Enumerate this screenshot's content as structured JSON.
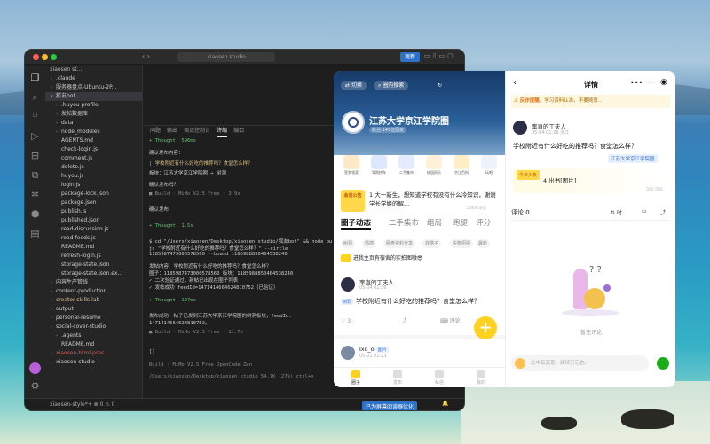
{
  "vscode": {
    "title": "xiaosen studio",
    "title_button": "更新",
    "explorer_root": "xiaosen st...",
    "tree": [
      {
        "label": ".claude",
        "type": "folder",
        "color": "normal",
        "indent": 1,
        "selected": false
      },
      {
        "label": "服务器盘点-Ubuntu-2P...",
        "type": "folder",
        "color": "normal",
        "indent": 1,
        "selected": false
      },
      {
        "label": "狐友bot",
        "type": "folder-open",
        "color": "normal",
        "indent": 1,
        "selected": true
      },
      {
        "label": ".huyou-profile",
        "type": "folder",
        "color": "normal",
        "indent": 2,
        "selected": false
      },
      {
        "label": "发帖数据库",
        "type": "folder",
        "color": "normal",
        "indent": 2,
        "selected": false
      },
      {
        "label": "data",
        "type": "folder",
        "color": "normal",
        "indent": 2,
        "selected": false
      },
      {
        "label": "node_modules",
        "type": "folder",
        "color": "normal",
        "indent": 2,
        "selected": false
      },
      {
        "label": "AGENTS.md",
        "type": "file",
        "color": "normal",
        "indent": 2,
        "selected": false
      },
      {
        "label": "check-login.js",
        "type": "file",
        "color": "normal",
        "indent": 2,
        "selected": false
      },
      {
        "label": "comment.js",
        "type": "file",
        "color": "normal",
        "indent": 2,
        "selected": false
      },
      {
        "label": "delete.js",
        "type": "file",
        "color": "normal",
        "indent": 2,
        "selected": false
      },
      {
        "label": "huyou.js",
        "type": "file",
        "color": "normal",
        "indent": 2,
        "selected": false
      },
      {
        "label": "login.js",
        "type": "file",
        "color": "normal",
        "indent": 2,
        "selected": false
      },
      {
        "label": "package-lock.json",
        "type": "file",
        "color": "normal",
        "indent": 2,
        "selected": false
      },
      {
        "label": "package.json",
        "type": "file",
        "color": "normal",
        "indent": 2,
        "selected": false
      },
      {
        "label": "publish.js",
        "type": "file",
        "color": "normal",
        "indent": 2,
        "selected": false
      },
      {
        "label": "published.json",
        "type": "file",
        "color": "normal",
        "indent": 2,
        "selected": false
      },
      {
        "label": "read-discussion.js",
        "type": "file",
        "color": "normal",
        "indent": 2,
        "selected": false
      },
      {
        "label": "read-feeds.js",
        "type": "file",
        "color": "normal",
        "indent": 2,
        "selected": false
      },
      {
        "label": "README.md",
        "type": "file",
        "color": "normal",
        "indent": 2,
        "selected": false
      },
      {
        "label": "refresh-login.js",
        "type": "file",
        "color": "normal",
        "indent": 2,
        "selected": false
      },
      {
        "label": "storage-state.json",
        "type": "file",
        "color": "normal",
        "indent": 2,
        "selected": false
      },
      {
        "label": "storage-state.json.ex...",
        "type": "file",
        "color": "normal",
        "indent": 2,
        "selected": false
      },
      {
        "label": "内容生产管线",
        "type": "folder",
        "color": "normal",
        "indent": 1,
        "selected": false
      },
      {
        "label": "content-production",
        "type": "folder",
        "color": "normal",
        "indent": 1,
        "selected": false
      },
      {
        "label": "creator-skills-lab",
        "type": "folder",
        "color": "orange",
        "indent": 1,
        "selected": false
      },
      {
        "label": "output",
        "type": "folder",
        "color": "normal",
        "indent": 1,
        "selected": false
      },
      {
        "label": "personal-resume",
        "type": "folder",
        "color": "normal",
        "indent": 1,
        "selected": false
      },
      {
        "label": "social-cover-studio",
        "type": "folder",
        "color": "normal",
        "indent": 1,
        "selected": false
      },
      {
        "label": ".agents",
        "type": "folder",
        "color": "normal",
        "indent": 2,
        "selected": false
      },
      {
        "label": "README.md",
        "type": "file",
        "color": "normal",
        "indent": 2,
        "selected": false
      },
      {
        "label": "xiaosen-html-pres...",
        "type": "folder",
        "color": "red",
        "indent": 1,
        "selected": false
      },
      {
        "label": "xiaosen-studio",
        "type": "folder",
        "color": "normal",
        "indent": 1,
        "selected": false
      }
    ],
    "panel_tabs": [
      "问题",
      "输出",
      "调试控制台",
      "终端",
      "端口"
    ],
    "active_panel_tab": "终端",
    "terminal_lines": [
      {
        "text": "+ Thought: 596ms",
        "style": "g"
      },
      {
        "text": "确认发布内容：",
        "style": ""
      },
      {
        "text": "| 学校附近有什么好吃的推荐吗？食堂怎么样？",
        "style": "y"
      },
      {
        "text": "板块：江苏大学京江学院圈 → 树洞",
        "style": ""
      },
      {
        "text": "确认发布吗？",
        "style": ""
      },
      {
        "text": "■  Build · MiMo V2.5 Free · 3.9s",
        "style": "dim"
      },
      {
        "text": "确认发布",
        "style": ""
      },
      {
        "text": "+ Thought: 1.5s",
        "style": "g"
      },
      {
        "text": "$ cd \"/Users/xiaosen/Desktop/xiaosen studio/狐友bot\" && node pu",
        "style": ""
      },
      {
        "text": "js \"学校附近有什么好吃的推荐吗？食堂怎么样？\" --circle",
        "style": ""
      },
      {
        "text": "1185987473000578560 --board 1185988850464538240",
        "style": ""
      },
      {
        "text": "发帖内容：学校附近有什么好吃的推荐吗？食堂怎么样？",
        "style": ""
      },
      {
        "text": "圈子：1185987473000578560 板块：1185988850464538240",
        "style": ""
      },
      {
        "text": "✓ 二次验证通过，新帖已出现在圈子列表",
        "style": ""
      },
      {
        "text": "✓ 发帖成功 feedId=1471414664624810752（已验证）",
        "style": ""
      },
      {
        "text": "+ Thought: 107ms",
        "style": "g"
      },
      {
        "text": "发布成功！帖子已发到江苏大学京江学院圈的树洞板块，feedId:",
        "style": ""
      },
      {
        "text": "1471414664624810752。",
        "style": ""
      },
      {
        "text": "■  Build · MiMo V2.5 Free · 11.7s",
        "style": "dim"
      },
      {
        "text": "[]",
        "style": ""
      },
      {
        "text": "Build · MiMo V2.5 Free OpenCode Zen",
        "style": "dim"
      },
      {
        "text": "/Users/xiaosen/Desktop/xiaosen studio         54.7K (27%)    ctrl+p",
        "style": "dim"
      }
    ],
    "status_left": "xiaosen-style*+  ⊗ 0 ⚠ 0",
    "status_button": "已为屏幕阅读器优化"
  },
  "mini_program": {
    "switch_label": "切换",
    "search_label": "圈内搜索",
    "school_name": "江苏大学京江学院圈",
    "school_stats": "粉丝·149位圈友",
    "categories": [
      {
        "label": "签到领奖",
        "icon": "gift-icon"
      },
      {
        "label": "驾照拼车",
        "icon": "car-icon"
      },
      {
        "label": "二手集市",
        "icon": "cart-icon"
      },
      {
        "label": "校园同乐",
        "icon": "mascot-icon"
      },
      {
        "label": "京江百科",
        "icon": "book-icon"
      },
      {
        "label": "玩吧",
        "icon": "game-icon"
      }
    ],
    "notice_badge": "会员公告",
    "notice_text": "1 大一新生，想知道学校有没有什么冷知识，谢谢学长学姐的解...",
    "notice_meta": "5064 浏览",
    "tabs": [
      "圈子动态",
      "二手集市",
      "组局",
      "跑腿",
      "评分"
    ],
    "active_tab": "圈子动态",
    "filters": [
      "树洞",
      "情感",
      "网盘资料分享",
      "找搭子",
      "失物招领",
      "最新"
    ],
    "joined_notice": "进我主页有宿舍的实拍图嗷😎",
    "post1_name": "率直的丁夫人",
    "post1_time": "05-04 01:36",
    "post1_tag": "树洞",
    "post1_text": "学校附近有什么好吃的推荐吗？食堂怎么样？",
    "post1_likes": "3",
    "post1_comment": "评论",
    "post2_name": "lxo_o",
    "post2_time": "05-01 01:23",
    "post2_badge": "图片",
    "bottom_nav": [
      "圈子",
      "发布",
      "私信",
      "我的"
    ],
    "active_nav": "圈子",
    "fab": "+"
  },
  "detail": {
    "title": "详情",
    "warn_label": "反诈提醒",
    "warn_text": "学习资料认准，不要随意..",
    "author": "率直的丁夫人",
    "time": "05-04 01:36  浙江",
    "content": "学校附近有什么好吃的推荐吗？食堂怎么样？",
    "group_tag": "江苏大学京江学院圈",
    "hot_badge": "今日头条",
    "card_text": "4 出书[图片]",
    "card_meta": "395 浏览",
    "comment_label": "评论 0",
    "sort_label": "时",
    "empty_text": "暂无评论",
    "input_placeholder": "此中有真意，欲辩已忘言。"
  }
}
